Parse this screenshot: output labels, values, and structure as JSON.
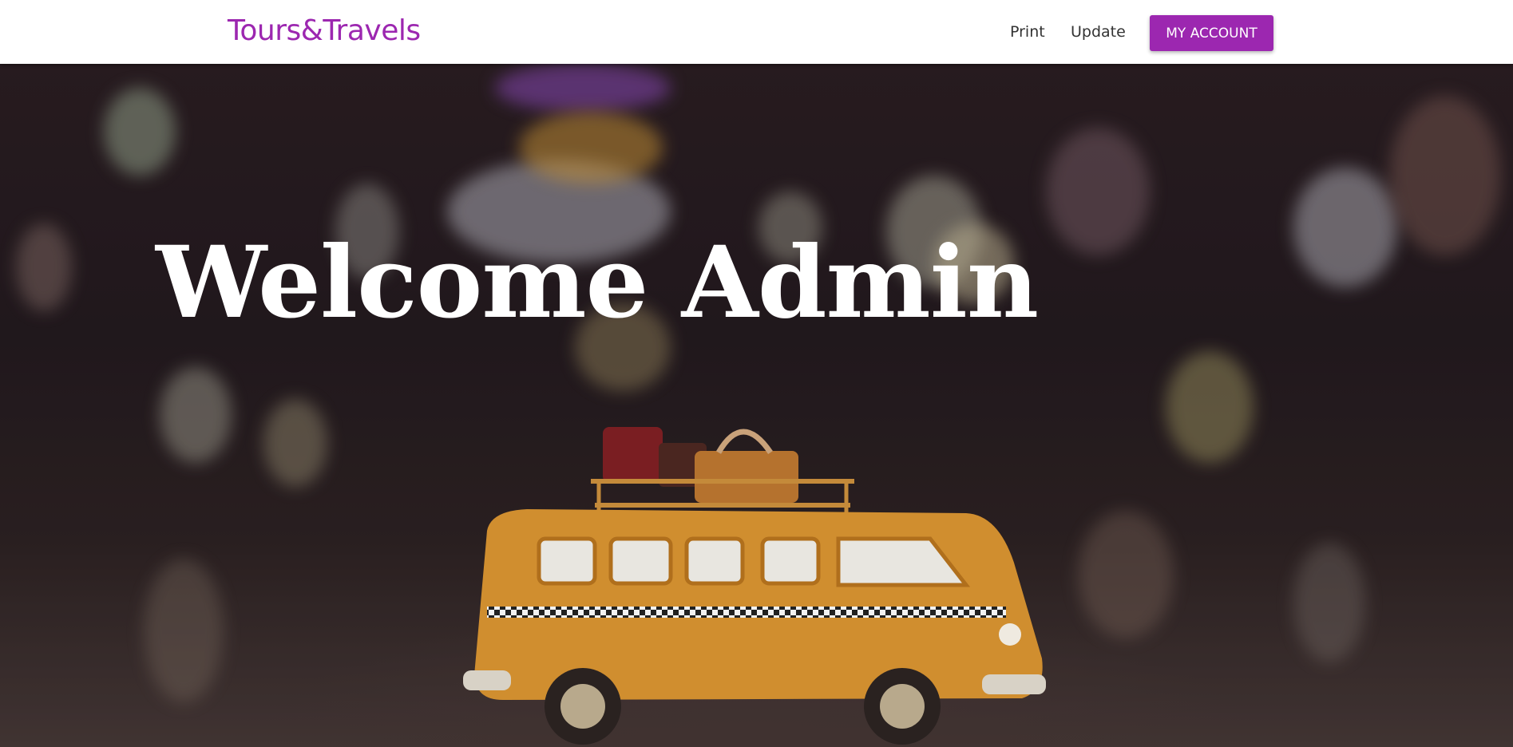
{
  "header": {
    "brand": "Tours&Travels",
    "nav": {
      "print_label": "Print",
      "update_label": "Update"
    },
    "account_button_label": "MY ACCOUNT"
  },
  "hero": {
    "heading": "Welcome Admin",
    "image": "toy-bus-with-luggage-bokeh-photo"
  },
  "colors": {
    "accent": "#9c27b0",
    "navbar_bg": "#ffffff"
  }
}
